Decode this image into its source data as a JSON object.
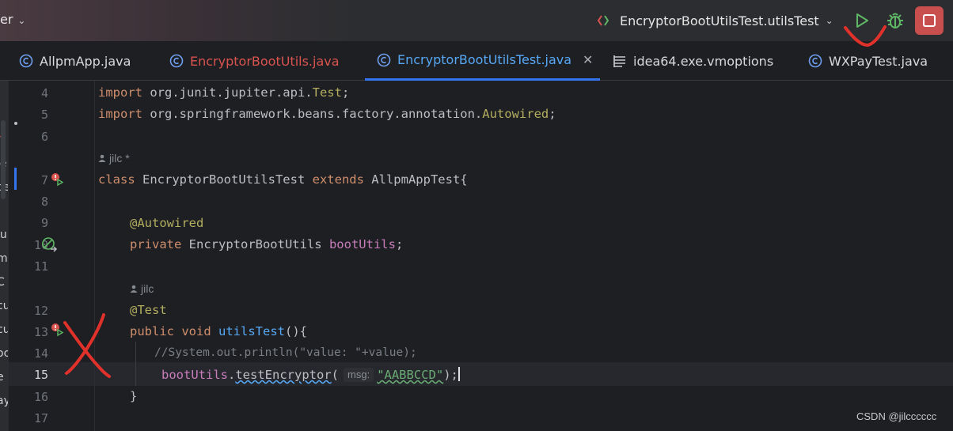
{
  "titlebar": {
    "project_fragment": "er",
    "run_config": "EncryptorBootUtilsTest.utilsTest"
  },
  "tabs": [
    {
      "label": "AllpmApp.java",
      "color": "#d7d9dd"
    },
    {
      "label": "EncryptorBootUtils.java",
      "color": "#d9534f"
    },
    {
      "label": "EncryptorBootUtilsTest.java",
      "color": "#56a8f5",
      "active": true
    },
    {
      "label": "idea64.exe.vmoptions",
      "color": "#d7d9dd"
    },
    {
      "label": "WXPayTest.java",
      "color": "#d7d9dd"
    }
  ],
  "left_strip": [
    "rl",
    "ie",
    "ce",
    "lu",
    "m",
    "C",
    "cu",
    "cu",
    "oc",
    "e",
    "ay"
  ],
  "editor": {
    "line_numbers": [
      "4",
      "5",
      "6",
      "7",
      "8",
      "9",
      "10",
      "11",
      "12",
      "13",
      "14",
      "15",
      "16",
      "17"
    ],
    "line4": {
      "kw": "import",
      "rest": " org.junit.jupiter.api.",
      "ann": "Test",
      "end": ";"
    },
    "line5": {
      "kw": "import",
      "rest": " org.springframework.beans.factory.annotation.",
      "ann": "Autowired",
      "end": ";"
    },
    "author1": "jilc *",
    "line7": {
      "kw1": "class",
      "name": " EncryptorBootUtilsTest ",
      "kw2": "extends",
      "rest": " AllpmAppTest{"
    },
    "line9": {
      "ann": "@Autowired"
    },
    "line10": {
      "kw": "private",
      "type": " EncryptorBootUtils ",
      "fld": "bootUtils",
      "end": ";"
    },
    "author2": "jilc",
    "line12": {
      "ann": "@Test"
    },
    "line13": {
      "kw1": "public",
      "kw2": " void ",
      "mth": "utilsTest",
      "end": "(){"
    },
    "line14": {
      "cmt": "//System.out.println(\"value: \"+value);"
    },
    "line15": {
      "fld": "bootUtils",
      "dot": ".",
      "mth": "testEncryptor",
      "open": "(",
      "hint": "msg:",
      "str": "\"AABBCCD\"",
      "end": ");"
    },
    "line16": {
      "end": "}"
    }
  },
  "watermark": "CSDN @jilcccccc"
}
